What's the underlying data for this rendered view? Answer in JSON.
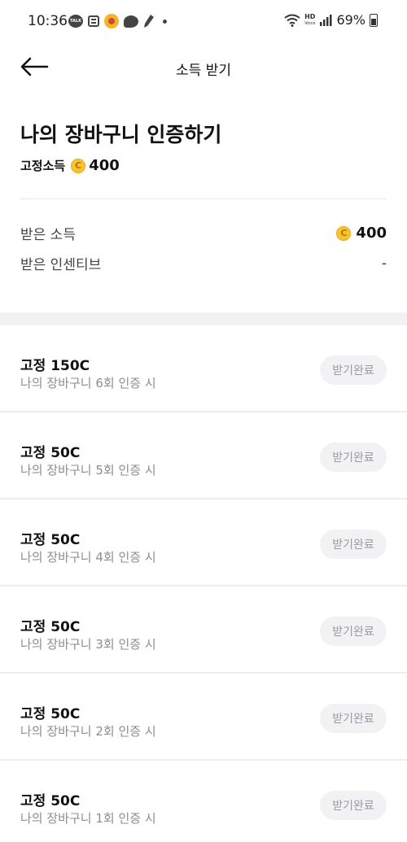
{
  "status_bar": {
    "time": "10:36",
    "talk_icon_text": "TALK",
    "hd_text": "HD",
    "voice_text": "Voice",
    "battery": "69%"
  },
  "header": {
    "title": "소득 받기"
  },
  "mission": {
    "title": "나의 장바구니 인증하기",
    "fixed_label": "고정소득",
    "coin_symbol": "C",
    "fixed_value": "400"
  },
  "summary": {
    "received_income_label": "받은 소득",
    "received_income_value": "400",
    "received_incentive_label": "받은 인센티브",
    "received_incentive_value": "-"
  },
  "rewards": [
    {
      "title": "고정 150C",
      "desc": "나의 장바구니 6회 인증 시",
      "button": "받기완료"
    },
    {
      "title": "고정 50C",
      "desc": "나의 장바구니 5회 인증 시",
      "button": "받기완료"
    },
    {
      "title": "고정 50C",
      "desc": "나의 장바구니 4회 인증 시",
      "button": "받기완료"
    },
    {
      "title": "고정 50C",
      "desc": "나의 장바구니 3회 인증 시",
      "button": "받기완료"
    },
    {
      "title": "고정 50C",
      "desc": "나의 장바구니 2회 인증 시",
      "button": "받기완료"
    },
    {
      "title": "고정 50C",
      "desc": "나의 장바구니 1회 인증 시",
      "button": "받기완료"
    }
  ],
  "colors": {
    "coin": "#f7c234",
    "completed_button_bg": "#f2f2f5",
    "completed_button_text": "#9a9aa0",
    "section_gap": "#f2f2f5"
  }
}
